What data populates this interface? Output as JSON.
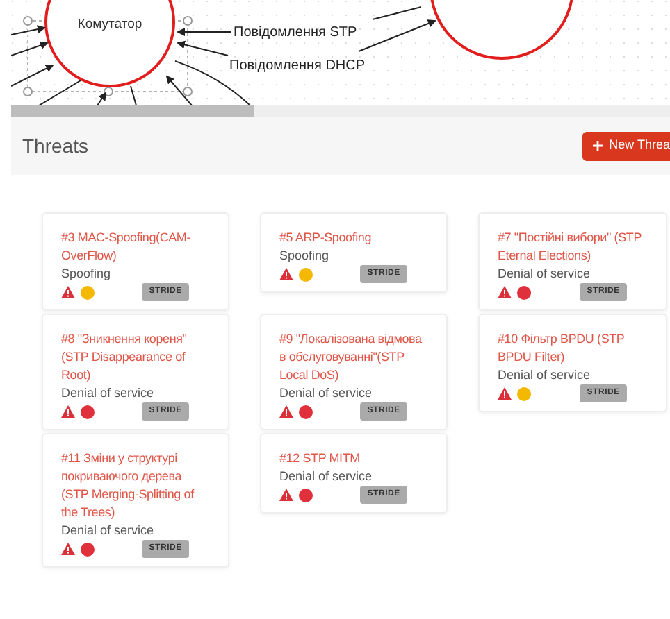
{
  "diagram": {
    "nodes": [
      {
        "label": "Комутатор"
      }
    ],
    "flows": [
      {
        "label": "Повідомлення STP"
      },
      {
        "label": "Повідомлення DHCP"
      }
    ]
  },
  "threats_panel": {
    "title": "Threats",
    "new_button": "New Threa",
    "threats": [
      {
        "title": "#3 MAC-Spoofing(CAM-OverFlow)",
        "type": "Spoofing",
        "color": "#f5b800",
        "model": "STRIDE"
      },
      {
        "title": "#5 ARP-Spoofing",
        "type": "Spoofing",
        "color": "#f5b800",
        "model": "STRIDE"
      },
      {
        "title": "#7 \"Постійні вибори\" (STP Eternal Elections)",
        "type": "Denial of service",
        "color": "#e0303c",
        "model": "STRIDE"
      },
      {
        "title": "#8 \"Зникнення кореня\" (STP Disappearance of Root)",
        "type": "Denial of service",
        "color": "#e0303c",
        "model": "STRIDE"
      },
      {
        "title": "#9 \"Локалізована відмова в обслуговуванні\"(STP Local DoS)",
        "type": "Denial of service",
        "color": "#e0303c",
        "model": "STRIDE"
      },
      {
        "title": "#10 Фільтр BPDU (STP BPDU Filter)",
        "type": "Denial of service",
        "color": "#f5b800",
        "model": "STRIDE"
      },
      {
        "title": "#11 Зміни у структурі покриваючого дерева (STP Merging-Splitting of the Trees)",
        "type": "Denial of service",
        "color": "#e0303c",
        "model": "STRIDE"
      },
      {
        "title": "#12 STP MITM",
        "type": "Denial of service",
        "color": "#e0303c",
        "model": "STRIDE"
      }
    ]
  }
}
